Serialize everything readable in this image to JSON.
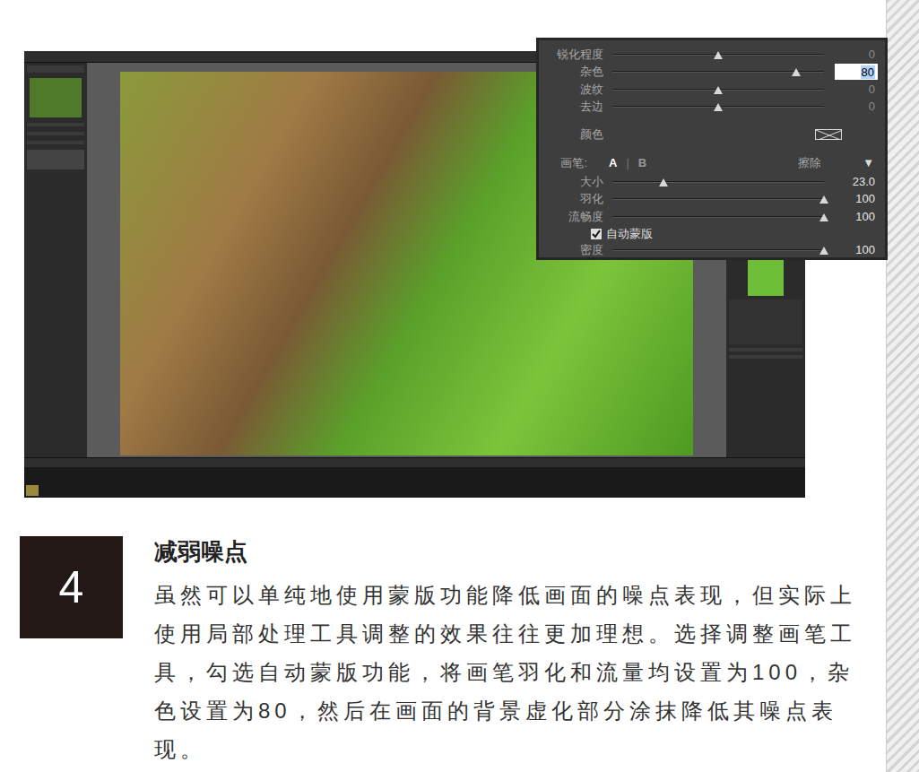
{
  "inset": {
    "sliders": [
      {
        "label": "锐化程度",
        "level": 0.5,
        "value": "0",
        "editing": false
      },
      {
        "label": "杂色",
        "level": 0.87,
        "value": "80",
        "editing": true
      },
      {
        "label": "波纹",
        "level": 0.5,
        "value": "0",
        "editing": false
      },
      {
        "label": "去边",
        "level": 0.5,
        "value": "0",
        "editing": false
      }
    ],
    "color_label": "颜色",
    "brush": {
      "label": "画笔:",
      "tabs": [
        {
          "label": "A",
          "selected": true
        },
        {
          "label": "B",
          "selected": false
        }
      ],
      "separator": "|",
      "erase": "擦除",
      "menu": "▼",
      "sliders": [
        {
          "label": "大小",
          "level": 0.24,
          "value": "23.0"
        },
        {
          "label": "羽化",
          "level": 1,
          "value": "100"
        },
        {
          "label": "流畅度",
          "level": 1,
          "value": "100"
        }
      ],
      "auto_mask": {
        "label": "自动蒙版",
        "checked": true
      },
      "density": {
        "label": "密度",
        "level": 1,
        "value": "100"
      }
    }
  },
  "step": {
    "number": "4",
    "title": "减弱噪点",
    "body": "虽然可以单纯地使用蒙版功能降低画面的噪点表现，但实际上使用局部处理工具调整的效果往往更加理想。选择调整画笔工具，勾选自动蒙版功能，将画笔羽化和流量均设置为100，杂色设置为80，然后在画面的背景虚化部分涂抹降低其噪点表现。"
  }
}
